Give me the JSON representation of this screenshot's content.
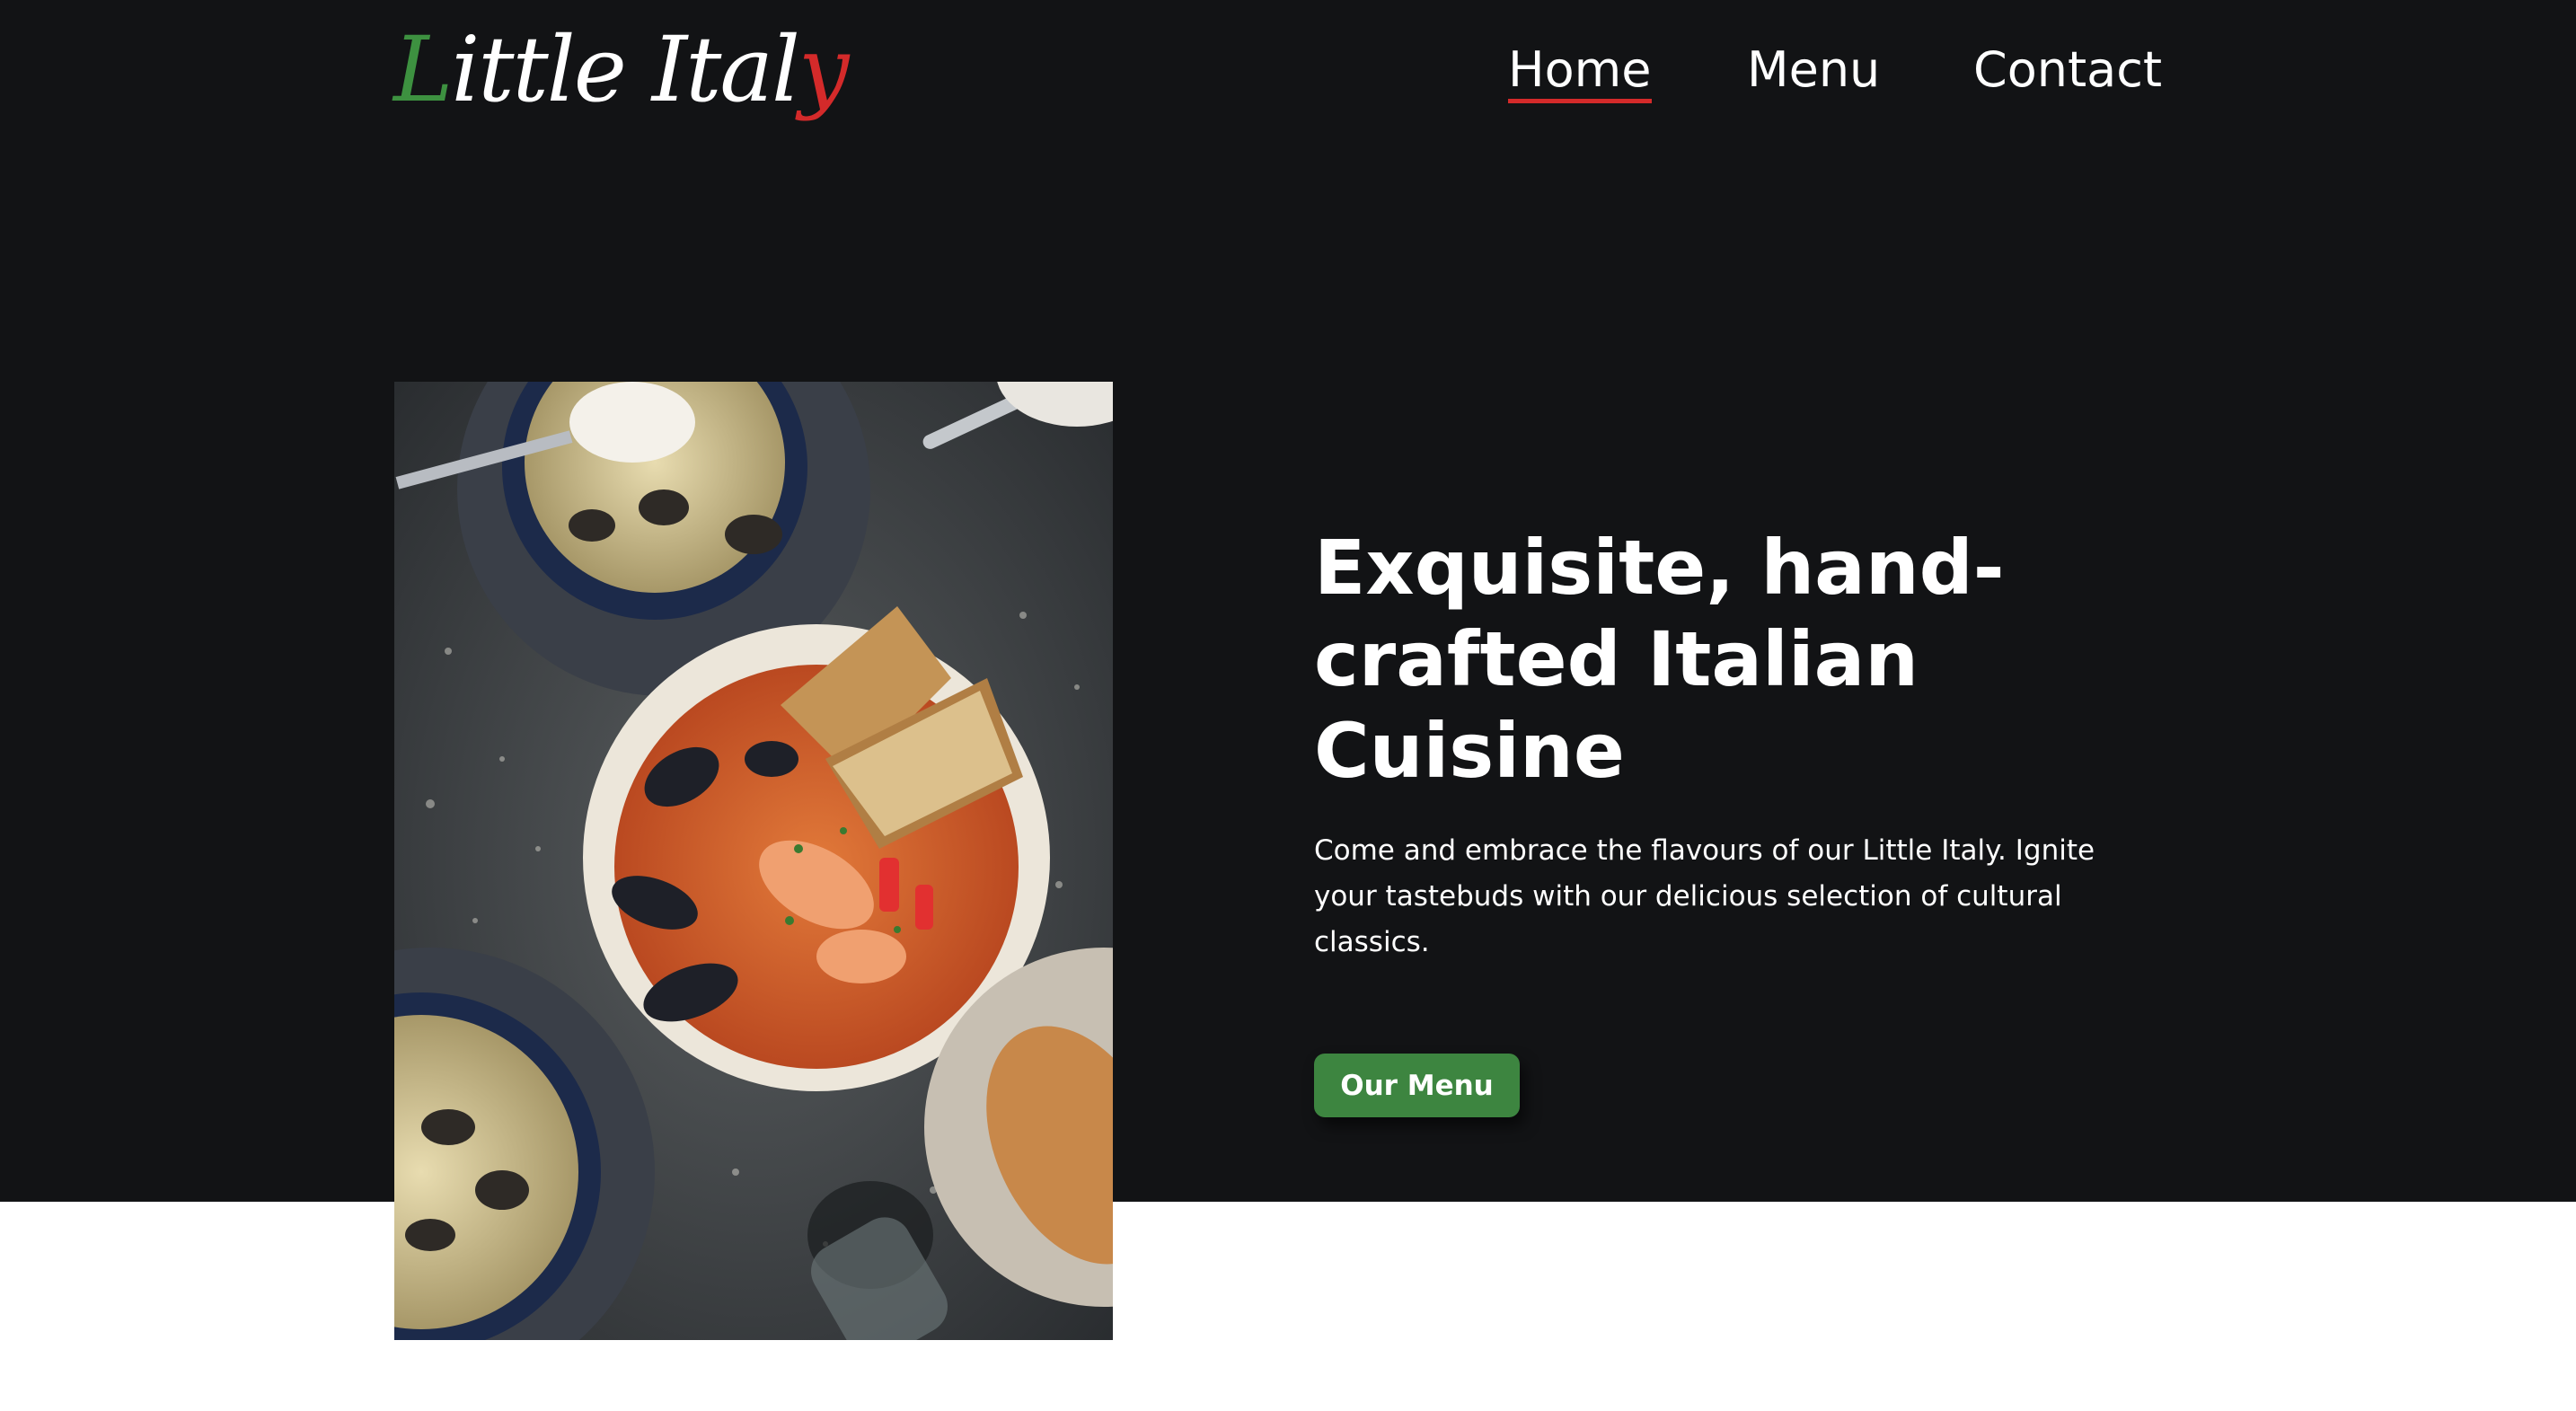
{
  "brand": {
    "first_letter": "L",
    "middle": "ittle Ital",
    "last_letter": "y",
    "first_letter_color": "#3d9140",
    "last_letter_color": "#d42a2a"
  },
  "nav": {
    "items": [
      {
        "label": "Home",
        "active": true
      },
      {
        "label": "Menu",
        "active": false
      },
      {
        "label": "Contact",
        "active": false
      }
    ],
    "active_color": "#d42a2a"
  },
  "hero": {
    "headline": "Exquisite, hand-crafted Italian Cuisine",
    "description": "Come and embrace the flavours of our Little Italy. Ignite your tastebuds with our delicious selection of cultural classics.",
    "cta_label": "Our Menu",
    "cta_color": "#3d8540",
    "background_color": "#121315"
  }
}
